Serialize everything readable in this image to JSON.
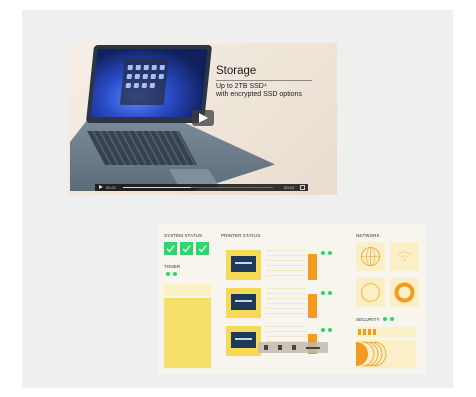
{
  "video1": {
    "title": "Storage",
    "subtitle_line1": "Up to 2TB SSD⁴",
    "subtitle_line2": "with encrypted SSD options",
    "time_current": "00:21",
    "time_total": "00:54",
    "progress": 0.45
  },
  "dashboard": {
    "system_status_label": "SYSTEM STATUS",
    "printer_status_label": "PRINTER STATUS",
    "network_label": "NETWORK",
    "toner_label": "TONER",
    "security_label": "SECURITY"
  },
  "colors": {
    "accent_green": "#2bd66a",
    "accent_orange": "#f39a1f",
    "accent_yellow": "#f6d955"
  }
}
